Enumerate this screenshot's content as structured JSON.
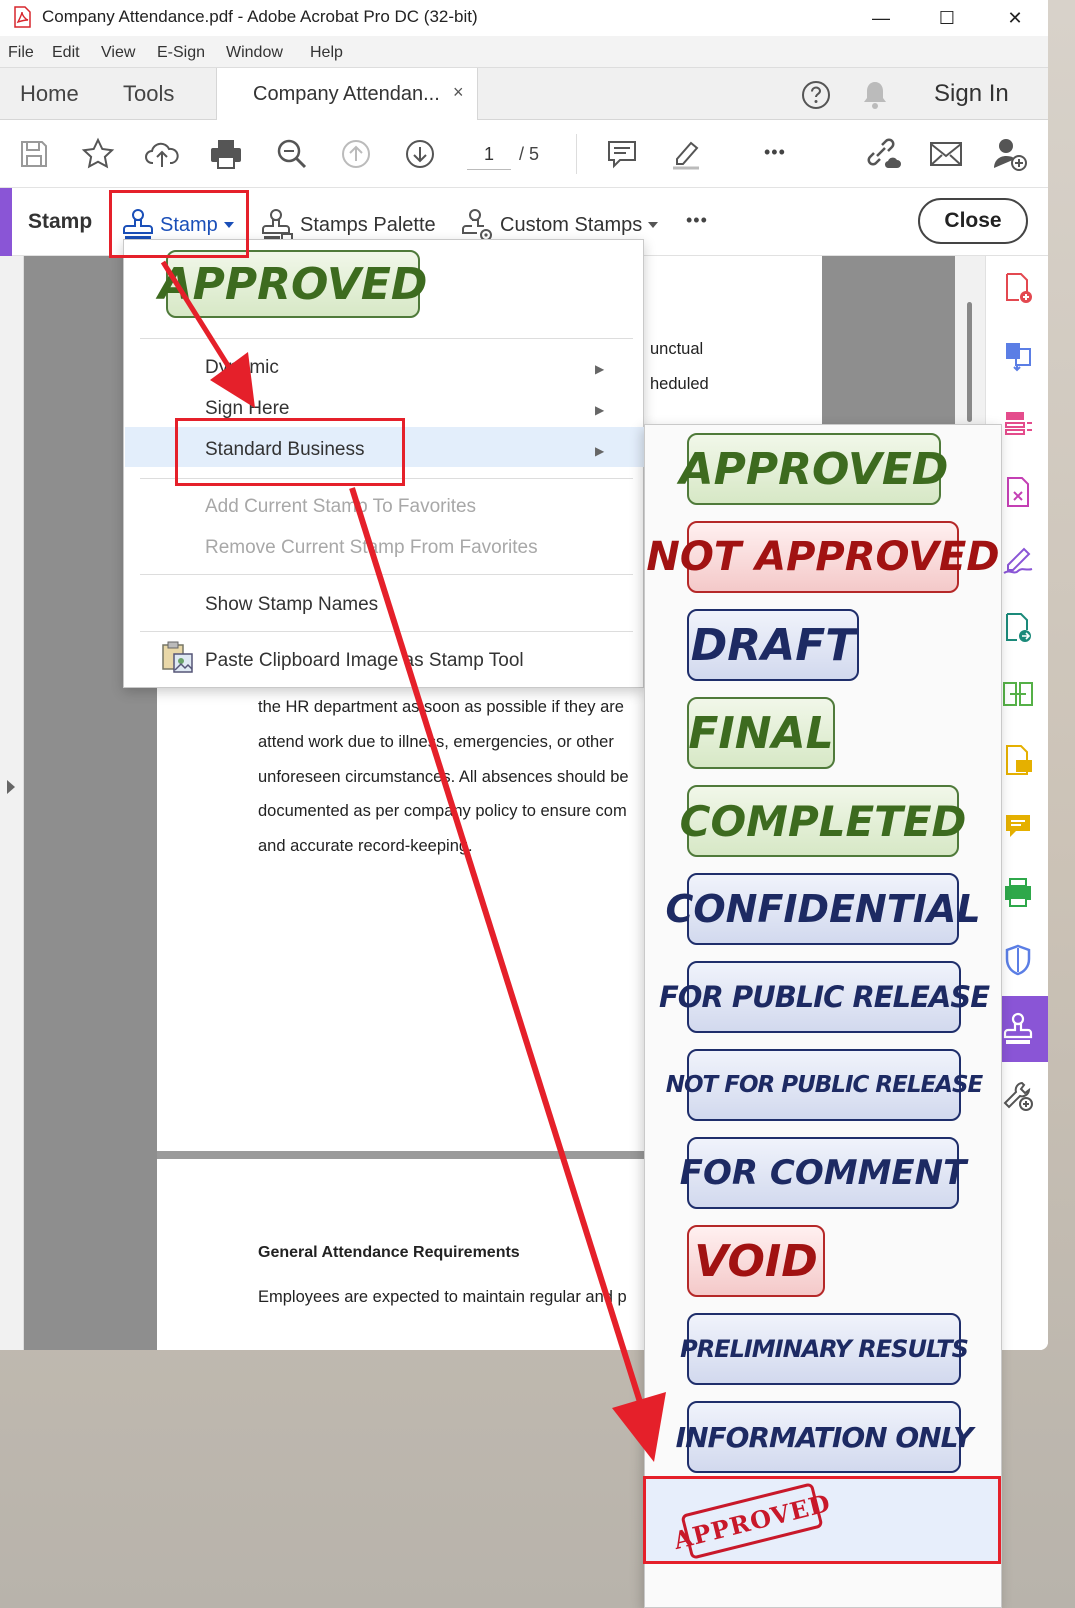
{
  "window": {
    "title": "Company Attendance.pdf - Adobe Acrobat Pro DC (32-bit)",
    "minimize": "—",
    "maximize": "☐",
    "close": "✕"
  },
  "menubar": [
    "File",
    "Edit",
    "View",
    "E-Sign",
    "Window",
    "Help"
  ],
  "tabs": {
    "home": "Home",
    "tools": "Tools",
    "document": "Company Attendan...",
    "close_tab": "×",
    "sign_in": "Sign In"
  },
  "toolbar": {
    "page_current": "1",
    "page_total": "/ 5",
    "more": "•••"
  },
  "stampbar": {
    "title": "Stamp",
    "stamp_dropdown": "Stamp",
    "stamps_palette": "Stamps Palette",
    "custom_stamps": "Custom Stamps",
    "more": "•••",
    "close": "Close"
  },
  "stamp_menu": {
    "recent_stamp": "APPROVED",
    "dynamic": "Dynamic",
    "sign_here": "Sign Here",
    "standard_business": "Standard Business",
    "add_favorites": "Add Current Stamp To Favorites",
    "remove_favorites": "Remove Current Stamp From Favorites",
    "show_names": "Show Stamp Names",
    "paste_clipboard": "Paste Clipboard Image as Stamp Tool"
  },
  "standard_business_stamps": [
    {
      "label": "APPROVED",
      "style": "green"
    },
    {
      "label": "NOT APPROVED",
      "style": "red"
    },
    {
      "label": "DRAFT",
      "style": "blue"
    },
    {
      "label": "FINAL",
      "style": "green"
    },
    {
      "label": "COMPLETED",
      "style": "green"
    },
    {
      "label": "CONFIDENTIAL",
      "style": "blue"
    },
    {
      "label": "FOR PUBLIC RELEASE",
      "style": "blue"
    },
    {
      "label": "NOT FOR PUBLIC RELEASE",
      "style": "blue"
    },
    {
      "label": "FOR COMMENT",
      "style": "blue"
    },
    {
      "label": "VOID",
      "style": "red"
    },
    {
      "label": "PRELIMINARY RESULTS",
      "style": "blue"
    },
    {
      "label": "INFORMATION ONLY",
      "style": "blue"
    }
  ],
  "custom_stamp_label": "APPROVED",
  "document": {
    "frag1": "unctual",
    "frag2": "heduled",
    "lines": [
      "the HR department as soon as possible if they are",
      "attend work due to illness, emergencies, or other",
      "unforeseen circumstances. All absences should be",
      "documented as per company policy to ensure com",
      "and accurate record-keeping."
    ],
    "heading": "General Attendance Requirements",
    "line_last": "Employees are expected to maintain regular and p"
  },
  "colors": {
    "accent": "#8a55d6",
    "annotation_red": "#e5202a",
    "stamp_green": "#3d6b1f",
    "stamp_red": "#a11212",
    "stamp_blue": "#1d2a63"
  }
}
